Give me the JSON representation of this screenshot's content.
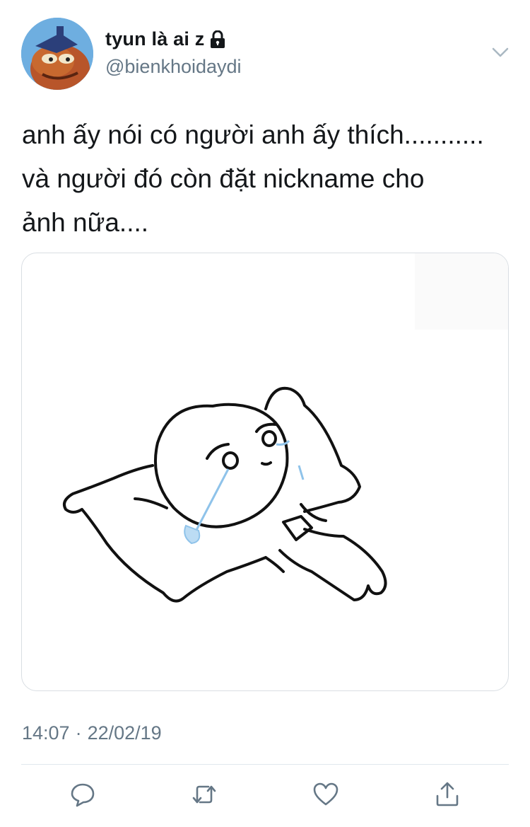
{
  "user": {
    "display_name": "tyun là ai z",
    "handle": "@bienkhoidaydi",
    "protected": true
  },
  "tweet": {
    "text": "anh ấy nói có người anh ấy thích...........\nvà người đó còn đặt nickname cho\nảnh nữa....",
    "time": "14:07",
    "separator": "·",
    "date": "22/02/19"
  },
  "actions": [
    {
      "name": "reply",
      "icon": "speech-bubble-icon"
    },
    {
      "name": "retweet",
      "icon": "retweet-icon"
    },
    {
      "name": "like",
      "icon": "heart-icon"
    },
    {
      "name": "share",
      "icon": "share-icon"
    }
  ],
  "colors": {
    "text": "#14171a",
    "secondary": "#657786",
    "border": "#e1e8ed",
    "icon": "#657786"
  }
}
